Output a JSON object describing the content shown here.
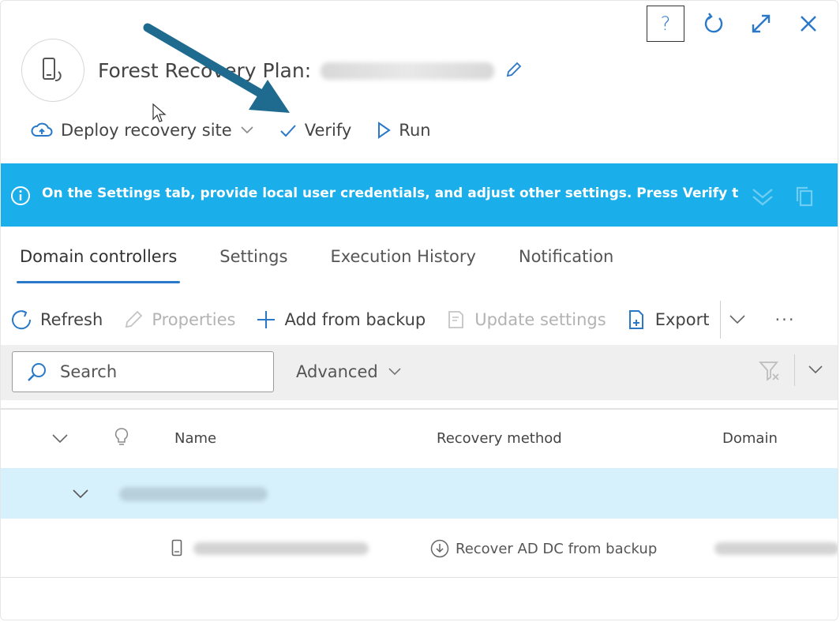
{
  "window": {
    "help_label": "?",
    "icons": [
      "refresh-icon",
      "expand-icon",
      "close-icon"
    ]
  },
  "header": {
    "title": "Forest Recovery Plan:",
    "edit_icon": "pencil-icon",
    "avatar_icon": "device-restore-icon"
  },
  "commands": {
    "deploy": "Deploy recovery site",
    "verify": "Verify",
    "run": "Run"
  },
  "banner": {
    "text": "On the Settings tab, provide local user credentials, and adjust other settings. Press Verify to ch",
    "color": "#1aaeea"
  },
  "tabs": [
    {
      "label": "Domain controllers",
      "active": true
    },
    {
      "label": "Settings",
      "active": false
    },
    {
      "label": "Execution History",
      "active": false
    },
    {
      "label": "Notification",
      "active": false
    }
  ],
  "toolbar": {
    "refresh": "Refresh",
    "properties": "Properties",
    "add_from_backup": "Add from backup",
    "update_settings": "Update settings",
    "export": "Export",
    "more": "···"
  },
  "search": {
    "placeholder": "Search",
    "advanced": "Advanced"
  },
  "table": {
    "columns": {
      "name": "Name",
      "recovery_method": "Recovery method",
      "domain": "Domain"
    },
    "rows": [
      {
        "recovery_method": "Recover AD DC from backup"
      }
    ]
  },
  "colors": {
    "accent": "#2a78c8",
    "annotation_arrow": "#1f6b8f",
    "group_row": "#d6f1fc"
  }
}
